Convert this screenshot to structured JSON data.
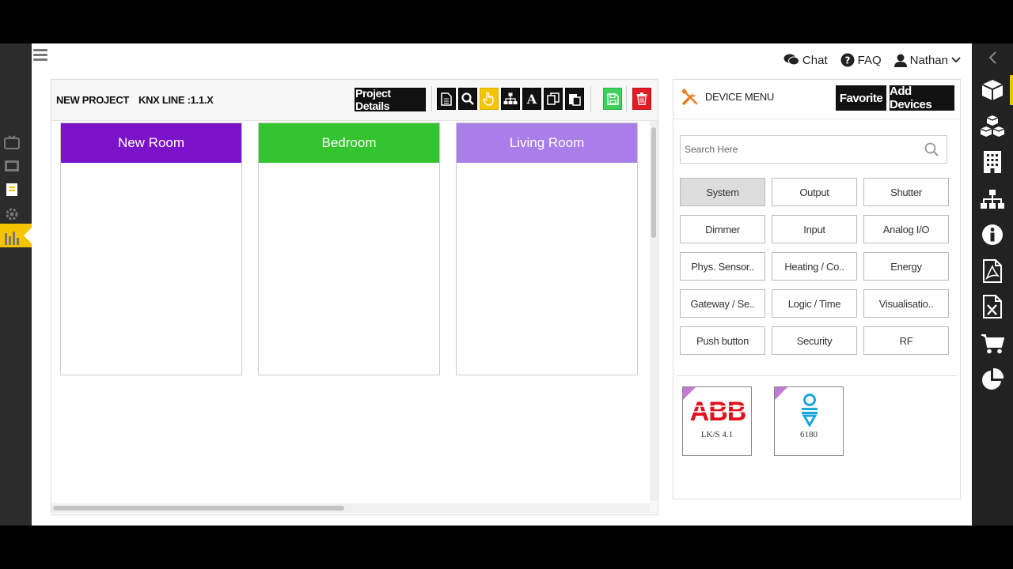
{
  "topnav": {
    "chat": "Chat",
    "faq": "FAQ",
    "user": "Nathan"
  },
  "project": {
    "name": "NEW PROJECT",
    "knx_line": "KNX LINE :1.1.X",
    "details_label": "Project Details"
  },
  "rooms": [
    {
      "name": "New Room",
      "color": "#7b13c9"
    },
    {
      "name": "Bedroom",
      "color": "#33c42f"
    },
    {
      "name": "Living Room",
      "color": "#a97ee8"
    }
  ],
  "device_menu": {
    "title": "DEVICE MENU",
    "favorite_label": "Favorite",
    "add_devices_label": "Add Devices",
    "search_placeholder": "Search Here",
    "categories": [
      "System",
      "Output",
      "Shutter",
      "Dimmer",
      "Input",
      "Analog I/O",
      "Phys. Sensor..",
      "Heating / Co..",
      "Energy",
      "Gateway / Se..",
      "Logic / Time",
      "Visualisatio..",
      "Push button",
      "Security",
      "RF"
    ],
    "active_category": "System",
    "devices": [
      {
        "brand": "ABB",
        "model": "LK/S 4.1"
      },
      {
        "brand": "",
        "model": "6180"
      }
    ]
  },
  "colors": {
    "accent": "#f5c400",
    "delete": "#e01b24",
    "save": "#3fcf5a",
    "abb_red": "#e2101a",
    "brand_blue": "#1aa6e0"
  }
}
